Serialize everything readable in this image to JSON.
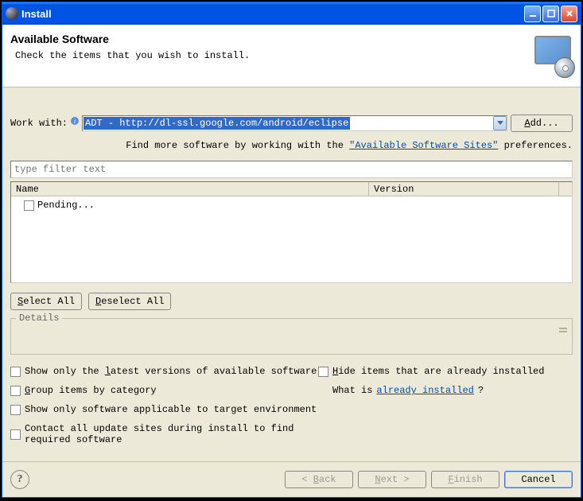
{
  "title": "Install",
  "header": {
    "title": "Available Software",
    "subtitle": "Check the items that you wish to install."
  },
  "workwith": {
    "label": "Work with:",
    "value": "ADT - http://dl-ssl.google.com/android/eclipse",
    "add_label": "Add..."
  },
  "softlink": {
    "prefix": "Find more software by working with the ",
    "link": "\"Available Software Sites\"",
    "suffix": " preferences."
  },
  "filter_placeholder": "type filter text",
  "table": {
    "col_name": "Name",
    "col_version": "Version",
    "pending": "Pending..."
  },
  "buttons": {
    "select_all": "Select All",
    "deselect_all": "Deselect All"
  },
  "details_label": "Details",
  "options": {
    "latest": "Show only the latest versions of available software",
    "group": "Group items by category",
    "applicable": "Show only software applicable to target environment",
    "contact": "Contact all update sites during install to find required software",
    "hide": "Hide items that are already installed",
    "whatis_prefix": "What is ",
    "whatis_link": "already installed",
    "whatis_suffix": "?"
  },
  "footer": {
    "back": "< Back",
    "next": "Next >",
    "finish": "Finish",
    "cancel": "Cancel"
  }
}
